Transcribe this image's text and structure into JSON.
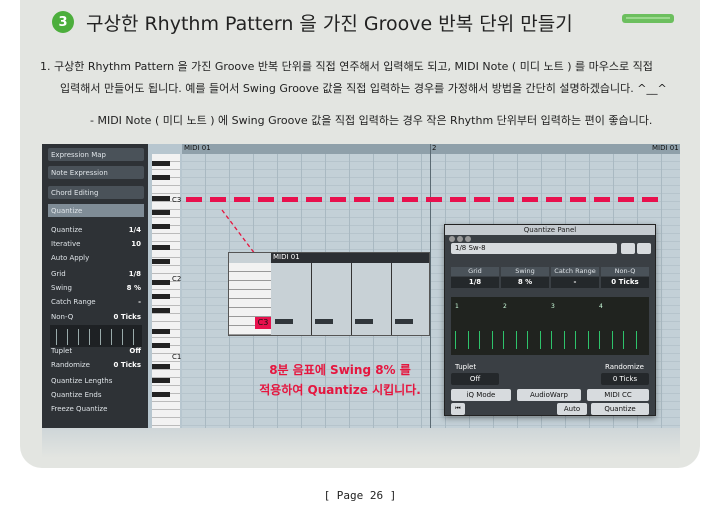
{
  "section": {
    "number": "3",
    "title": "구상한 Rhythm Pattern 을 가진 Groove 반복 단위 만들기"
  },
  "body": {
    "line1": "1. 구상한 Rhythm Pattern 을 가진 Groove 반복 단위를 직접 연주해서 입력해도 되고, MIDI Note ( 미디 노트 ) 를 마우스로 직접",
    "line2": "입력해서 만들어도 됩니다. 예를 들어서 Swing Groove 값을 직접 입력하는 경우를 가정해서 방법을 간단히 설명하겠습니다. ^__^",
    "note": "- MIDI Note ( 미디 노트 ) 에 Swing Groove 값을 직접 입력하는 경우 작은 Rhythm 단위부터 입력하는 편이 좋습니다."
  },
  "screenshot": {
    "inspector": [
      {
        "label": "Expression Map",
        "style": "hdr"
      },
      {
        "label": "Note Expression",
        "style": "hdr"
      },
      {
        "label": "Chord Editing",
        "style": "hdr"
      },
      {
        "label": "Quantize",
        "style": "sel"
      },
      {
        "label": "Quantize",
        "value": "1/4"
      },
      {
        "label": "Iterative",
        "value": "10"
      },
      {
        "label": "Auto Apply",
        "value": ""
      },
      {
        "label": "Grid",
        "value": "1/8"
      },
      {
        "label": "Swing",
        "value": "8 %"
      },
      {
        "label": "Catch Range",
        "value": "-"
      },
      {
        "label": "Non-Q",
        "value": "0 Ticks"
      },
      {
        "label": "Tuplet",
        "value": "Off"
      },
      {
        "label": "Randomize",
        "value": "0 Ticks"
      },
      {
        "label": "Quantize Lengths",
        "value": ""
      },
      {
        "label": "Quantize Ends",
        "value": ""
      },
      {
        "label": "Freeze Quantize",
        "value": ""
      }
    ],
    "ruler": {
      "bar1": "MIDI 01",
      "bar2": "2",
      "end": "MIDI 01"
    },
    "keys": {
      "c3": "C3",
      "c2": "C2",
      "c1": "C1"
    },
    "popup": {
      "title": "MIDI 01",
      "key": "C3"
    },
    "caption_line1": "8분 음표에 Swing 8% 를",
    "caption_line2": "적용하여 Quantize 시킵니다.",
    "quantize_panel": {
      "title": "Quantize Panel",
      "preset": "1/8 Sw-8",
      "columns": [
        {
          "label": "Grid",
          "value": "1/8"
        },
        {
          "label": "Swing",
          "value": "8 %"
        },
        {
          "label": "Catch Range",
          "value": "-"
        },
        {
          "label": "Non-Q",
          "value": "0 Ticks"
        }
      ],
      "graph_labels": [
        "1",
        "2",
        "3",
        "4"
      ],
      "tuplet_label": "Tuplet",
      "tuplet_value": "Off",
      "randomize_label": "Randomize",
      "randomize_value": "0 Ticks",
      "mode_buttons": [
        "iQ Mode",
        "AudioWarp",
        "MIDI CC"
      ],
      "auto": "Auto",
      "quantize": "Quantize"
    },
    "colors": {
      "note": "#e8104d",
      "quantize_grid": "#2ec46b",
      "section_badge": "#4cae3c"
    }
  },
  "footer": "[ Page 26 ]"
}
